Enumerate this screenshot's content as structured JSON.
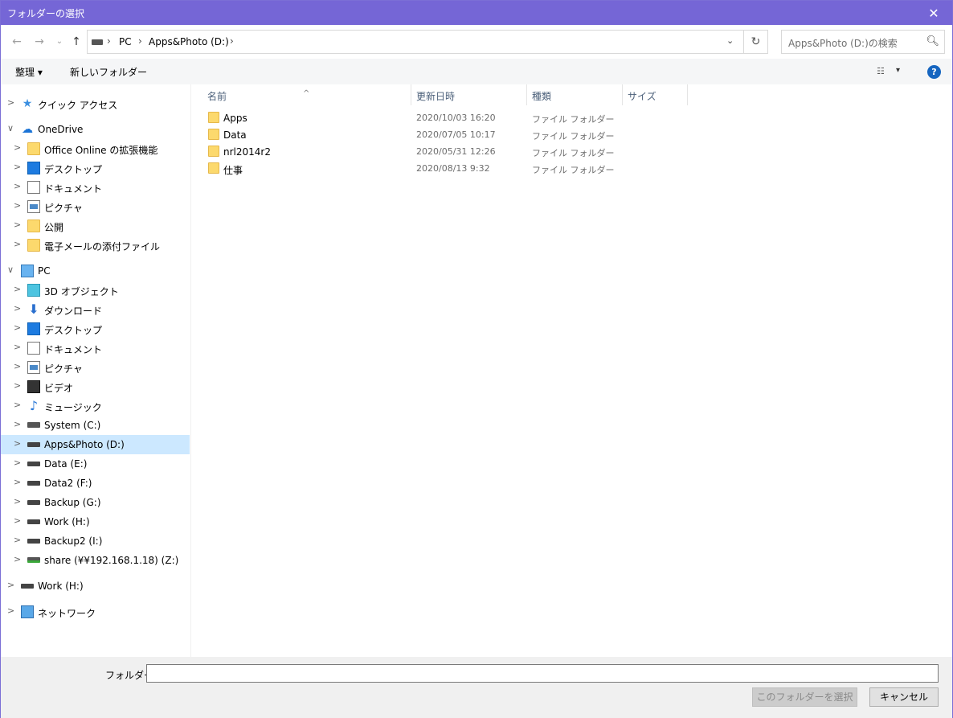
{
  "window": {
    "title": "フォルダーの選択",
    "close_glyph": "✕"
  },
  "nav": {
    "back": "←",
    "forward": "→",
    "recent": "⌄",
    "up": "↑"
  },
  "address": {
    "crumbs": [
      "PC",
      "Apps&Photo (D:)"
    ],
    "separator": "›",
    "dropdown": "⌄",
    "refresh": "↻"
  },
  "search": {
    "placeholder": "Apps&Photo (D:)の検索",
    "icon": "search-icon"
  },
  "toolbar": {
    "organize": "整理 ▾",
    "new_folder": "新しいフォルダー",
    "view_glyph": "☷",
    "view_dd": "▾",
    "help": "?"
  },
  "tree": [
    {
      "label": "クイック アクセス",
      "icon": "star-icon",
      "level": 0,
      "expander": ">"
    },
    {
      "label": "OneDrive",
      "icon": "cloud-icon",
      "level": 0,
      "expander": "∨"
    },
    {
      "label": "Office Online の拡張機能",
      "icon": "folder-icon",
      "level": 1,
      "expander": ">"
    },
    {
      "label": "デスクトップ",
      "icon": "desktop-icon",
      "level": 1,
      "expander": ">"
    },
    {
      "label": "ドキュメント",
      "icon": "document-icon",
      "level": 1,
      "expander": ">"
    },
    {
      "label": "ピクチャ",
      "icon": "pictures-icon",
      "level": 1,
      "expander": ">"
    },
    {
      "label": "公開",
      "icon": "folder-icon",
      "level": 1,
      "expander": ">"
    },
    {
      "label": "電子メールの添付ファイル",
      "icon": "folder-icon",
      "level": 1,
      "expander": ">"
    },
    {
      "label": "PC",
      "icon": "pc-icon",
      "level": 0,
      "expander": "∨"
    },
    {
      "label": "3D オブジェクト",
      "icon": "cube-icon",
      "level": 1,
      "expander": ">"
    },
    {
      "label": "ダウンロード",
      "icon": "download-icon",
      "level": 1,
      "expander": ">"
    },
    {
      "label": "デスクトップ",
      "icon": "desktop-icon",
      "level": 1,
      "expander": ">"
    },
    {
      "label": "ドキュメント",
      "icon": "document-icon",
      "level": 1,
      "expander": ">"
    },
    {
      "label": "ピクチャ",
      "icon": "pictures-icon",
      "level": 1,
      "expander": ">"
    },
    {
      "label": "ビデオ",
      "icon": "video-icon",
      "level": 1,
      "expander": ">"
    },
    {
      "label": "ミュージック",
      "icon": "music-icon",
      "level": 1,
      "expander": ">"
    },
    {
      "label": "System (C:)",
      "icon": "system-drive-icon",
      "level": 1,
      "expander": ">"
    },
    {
      "label": "Apps&Photo (D:)",
      "icon": "drive-icon",
      "level": 1,
      "expander": ">",
      "selected": true
    },
    {
      "label": "Data (E:)",
      "icon": "drive-icon",
      "level": 1,
      "expander": ">"
    },
    {
      "label": "Data2 (F:)",
      "icon": "drive-icon",
      "level": 1,
      "expander": ">"
    },
    {
      "label": "Backup (G:)",
      "icon": "drive-icon",
      "level": 1,
      "expander": ">"
    },
    {
      "label": "Work (H:)",
      "icon": "drive-icon",
      "level": 1,
      "expander": ">"
    },
    {
      "label": "Backup2 (I:)",
      "icon": "drive-icon",
      "level": 1,
      "expander": ">"
    },
    {
      "label": "share (¥¥192.168.1.18) (Z:)",
      "icon": "network-drive-icon",
      "level": 1,
      "expander": ">"
    },
    {
      "label": "Work (H:)",
      "icon": "drive-icon",
      "level": 0,
      "expander": ">"
    },
    {
      "label": "ネットワーク",
      "icon": "network-icon",
      "level": 0,
      "expander": ">"
    }
  ],
  "columns": {
    "name": "名前",
    "date": "更新日時",
    "type": "種類",
    "size": "サイズ",
    "sort_glyph": "^"
  },
  "files": [
    {
      "name": "Apps",
      "date": "2020/10/03 16:20",
      "type": "ファイル フォルダー"
    },
    {
      "name": "Data",
      "date": "2020/07/05 10:17",
      "type": "ファイル フォルダー"
    },
    {
      "name": "nrl2014r2",
      "date": "2020/05/31 12:26",
      "type": "ファイル フォルダー"
    },
    {
      "name": "仕事",
      "date": "2020/08/13 9:32",
      "type": "ファイル フォルダー"
    }
  ],
  "footer": {
    "folder_label": "フォルダー:",
    "folder_value": "",
    "select_button": "このフォルダーを選択",
    "cancel_button": "キャンセル"
  }
}
